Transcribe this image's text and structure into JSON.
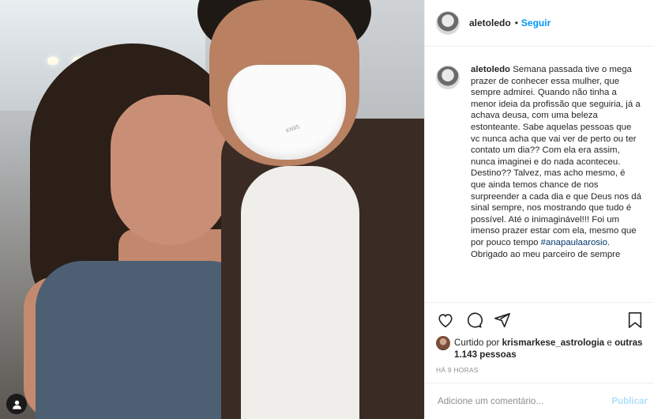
{
  "post": {
    "username": "aletoledo",
    "follow_label": "Seguir",
    "separator": "•"
  },
  "caption": {
    "username": "aletoledo",
    "text_before_tag": "Semana passada tive o mega prazer de conhecer essa mulher, que sempre admirei. Quando não tinha a menor ideia da profissão que seguiria, já a achava deusa, com uma beleza estonteante. Sabe aquelas pessoas que vc nunca acha que vai ver de perto ou ter contato um dia?? Com ela era assim, nunca imaginei e do nada aconteceu. Destino?? Talvez, mas acho mesmo, é que ainda temos chance de nos surpreender a cada dia e que Deus nos dá sinal sempre, nos mostrando que tudo é possível. Até o inimaginável!!! Foi um imenso prazer estar com ela, mesmo que por pouco tempo",
    "hashtag": "#anapaulaarosio",
    "text_after_tag": ". Obrigado ao meu parceiro de sempre"
  },
  "photo": {
    "mask_brand": "KN95"
  },
  "likes": {
    "prefix": "Curtido por",
    "liker": "krismarkese_astrologia",
    "connector": "e",
    "others": "outras 1.143 pessoas"
  },
  "timestamp": "HÁ 9 HORAS",
  "comment_box": {
    "placeholder": "Adicione um comentário...",
    "publish_label": "Publicar"
  }
}
